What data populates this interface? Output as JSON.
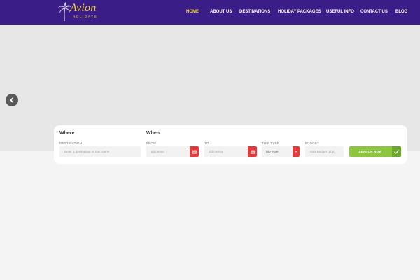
{
  "brand": {
    "name": "Avion",
    "tagline": "HOLIDAYS",
    "logo_color": "#f3d33a",
    "header_bg": "#3a1d86"
  },
  "nav": {
    "items": [
      {
        "label": "HOME",
        "active": true
      },
      {
        "label": "ABOUT US",
        "active": false
      },
      {
        "label": "DESTINATIONS",
        "active": false
      },
      {
        "label": "HOLIDAY PACKAGES",
        "active": false
      },
      {
        "label": "USEFUL INFO",
        "active": false
      },
      {
        "label": "CONTACT US",
        "active": false
      },
      {
        "label": "BLOG",
        "active": false
      }
    ]
  },
  "hero": {
    "prev_icon": "chevron-left-icon"
  },
  "search": {
    "where_title": "Where",
    "when_title": "When",
    "destination_label": "DESTINATION",
    "destination_placeholder": "Enter a destination or tour name",
    "from_label": "FROM",
    "from_placeholder": "dd/mm/yy",
    "to_label": "TO",
    "to_placeholder": "dd/mm/yy",
    "trip_type_label": "TRIP TYPE",
    "trip_type_value": "Trip Type",
    "budget_label": "BUDGET",
    "budget_placeholder": "Max Budget (gbp)",
    "search_button_label": "SEARCH NOW",
    "calendar_icon": "calendar-icon",
    "accent_red": "#e33b3b",
    "accent_green": "#8cc63f"
  }
}
